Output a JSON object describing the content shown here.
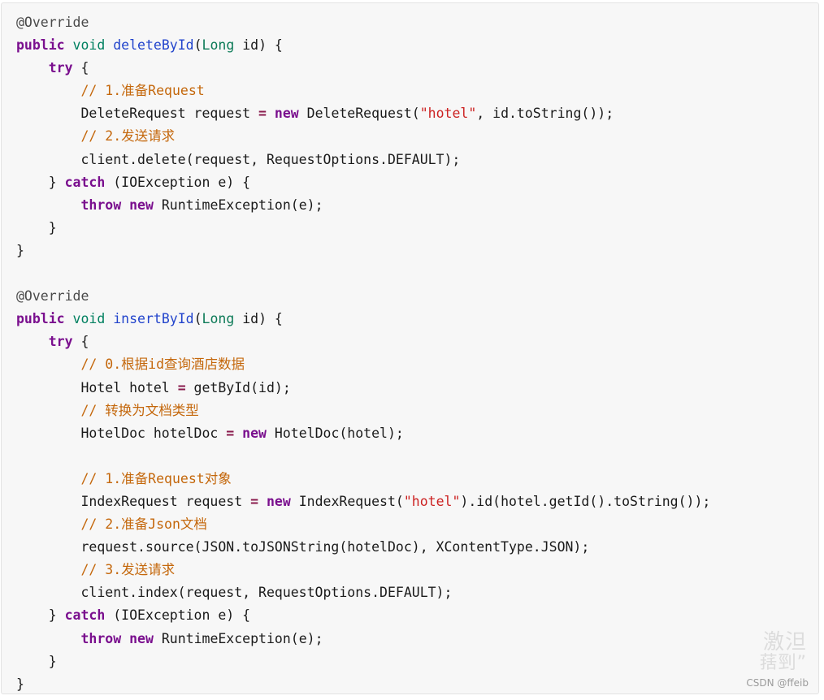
{
  "document": {
    "kind": "java-source-snippet",
    "language": "Java",
    "background_color": "#f7f7f7",
    "border_color": "#e3e3e3",
    "colors": {
      "keyword": "#7a0f8e",
      "return_type": "#008060",
      "generic_type": "#0c7a57",
      "method_name": "#2244cc",
      "annotation": "#4a4a4a",
      "comment": "#c4670b",
      "string": "#cc2222",
      "operator": "#8a1b4d",
      "plain": "#1a1a1a"
    }
  },
  "watermark": {
    "cn_line1": "激泹",
    "cn_line2": "葀剄”",
    "csdn": "CSDN @ffeib"
  },
  "code": {
    "lines": [
      [
        {
          "t": "@Override",
          "c": "ann"
        }
      ],
      [
        {
          "t": "public",
          "c": "kw"
        },
        {
          "t": " ",
          "c": "pln"
        },
        {
          "t": "void",
          "c": "ret"
        },
        {
          "t": " ",
          "c": "pln"
        },
        {
          "t": "deleteById",
          "c": "mth"
        },
        {
          "t": "(",
          "c": "pln"
        },
        {
          "t": "Long",
          "c": "gtyp"
        },
        {
          "t": " id) {",
          "c": "pln"
        }
      ],
      [
        {
          "t": "    ",
          "c": "pln"
        },
        {
          "t": "try",
          "c": "kw"
        },
        {
          "t": " {",
          "c": "pln"
        }
      ],
      [
        {
          "t": "        ",
          "c": "pln"
        },
        {
          "t": "// 1.准备Request",
          "c": "cmt"
        }
      ],
      [
        {
          "t": "        DeleteRequest request ",
          "c": "pln"
        },
        {
          "t": "=",
          "c": "op"
        },
        {
          "t": " ",
          "c": "pln"
        },
        {
          "t": "new",
          "c": "kw"
        },
        {
          "t": " DeleteRequest(",
          "c": "pln"
        },
        {
          "t": "\"hotel\"",
          "c": "str"
        },
        {
          "t": ", id.toString());",
          "c": "pln"
        }
      ],
      [
        {
          "t": "        ",
          "c": "pln"
        },
        {
          "t": "// 2.发送请求",
          "c": "cmt"
        }
      ],
      [
        {
          "t": "        client.delete(request, RequestOptions.DEFAULT);",
          "c": "pln"
        }
      ],
      [
        {
          "t": "    } ",
          "c": "pln"
        },
        {
          "t": "catch",
          "c": "kw"
        },
        {
          "t": " (IOException e) {",
          "c": "pln"
        }
      ],
      [
        {
          "t": "        ",
          "c": "pln"
        },
        {
          "t": "throw",
          "c": "kw"
        },
        {
          "t": " ",
          "c": "pln"
        },
        {
          "t": "new",
          "c": "kw"
        },
        {
          "t": " RuntimeException(e);",
          "c": "pln"
        }
      ],
      [
        {
          "t": "    }",
          "c": "pln"
        }
      ],
      [
        {
          "t": "}",
          "c": "pln"
        }
      ],
      [
        {
          "t": "",
          "c": "pln"
        }
      ],
      [
        {
          "t": "@Override",
          "c": "ann"
        }
      ],
      [
        {
          "t": "public",
          "c": "kw"
        },
        {
          "t": " ",
          "c": "pln"
        },
        {
          "t": "void",
          "c": "ret"
        },
        {
          "t": " ",
          "c": "pln"
        },
        {
          "t": "insertById",
          "c": "mth"
        },
        {
          "t": "(",
          "c": "pln"
        },
        {
          "t": "Long",
          "c": "gtyp"
        },
        {
          "t": " id) {",
          "c": "pln"
        }
      ],
      [
        {
          "t": "    ",
          "c": "pln"
        },
        {
          "t": "try",
          "c": "kw"
        },
        {
          "t": " {",
          "c": "pln"
        }
      ],
      [
        {
          "t": "        ",
          "c": "pln"
        },
        {
          "t": "// 0.根据id查询酒店数据",
          "c": "cmt"
        }
      ],
      [
        {
          "t": "        Hotel hotel ",
          "c": "pln"
        },
        {
          "t": "=",
          "c": "op"
        },
        {
          "t": " getById(id);",
          "c": "pln"
        }
      ],
      [
        {
          "t": "        ",
          "c": "pln"
        },
        {
          "t": "// 转换为文档类型",
          "c": "cmt"
        }
      ],
      [
        {
          "t": "        HotelDoc hotelDoc ",
          "c": "pln"
        },
        {
          "t": "=",
          "c": "op"
        },
        {
          "t": " ",
          "c": "pln"
        },
        {
          "t": "new",
          "c": "kw"
        },
        {
          "t": " HotelDoc(hotel);",
          "c": "pln"
        }
      ],
      [
        {
          "t": "",
          "c": "pln"
        }
      ],
      [
        {
          "t": "        ",
          "c": "pln"
        },
        {
          "t": "// 1.准备Request对象",
          "c": "cmt"
        }
      ],
      [
        {
          "t": "        IndexRequest request ",
          "c": "pln"
        },
        {
          "t": "=",
          "c": "op"
        },
        {
          "t": " ",
          "c": "pln"
        },
        {
          "t": "new",
          "c": "kw"
        },
        {
          "t": " IndexRequest(",
          "c": "pln"
        },
        {
          "t": "\"hotel\"",
          "c": "str"
        },
        {
          "t": ").id(hotel.getId().toString());",
          "c": "pln"
        }
      ],
      [
        {
          "t": "        ",
          "c": "pln"
        },
        {
          "t": "// 2.准备Json文档",
          "c": "cmt"
        }
      ],
      [
        {
          "t": "        request.source(JSON.toJSONString(hotelDoc), XContentType.JSON);",
          "c": "pln"
        }
      ],
      [
        {
          "t": "        ",
          "c": "pln"
        },
        {
          "t": "// 3.发送请求",
          "c": "cmt"
        }
      ],
      [
        {
          "t": "        client.index(request, RequestOptions.DEFAULT);",
          "c": "pln"
        }
      ],
      [
        {
          "t": "    } ",
          "c": "pln"
        },
        {
          "t": "catch",
          "c": "kw"
        },
        {
          "t": " (IOException e) {",
          "c": "pln"
        }
      ],
      [
        {
          "t": "        ",
          "c": "pln"
        },
        {
          "t": "throw",
          "c": "kw"
        },
        {
          "t": " ",
          "c": "pln"
        },
        {
          "t": "new",
          "c": "kw"
        },
        {
          "t": " RuntimeException(e);",
          "c": "pln"
        }
      ],
      [
        {
          "t": "    }",
          "c": "pln"
        }
      ],
      [
        {
          "t": "}",
          "c": "pln"
        }
      ]
    ]
  }
}
